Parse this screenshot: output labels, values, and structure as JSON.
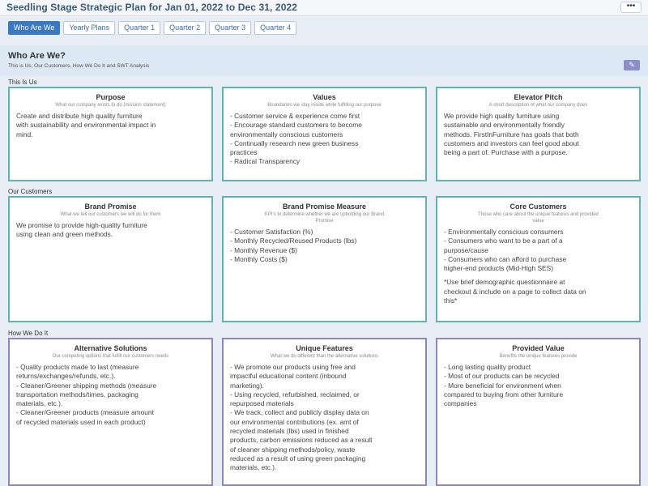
{
  "header": {
    "title": "Seedling Stage Strategic Plan for Jan 01, 2022 to Dec 31, 2022",
    "more_label": "•••"
  },
  "tabs": [
    {
      "label": "Who Are We",
      "active": true
    },
    {
      "label": "Yearly Plans",
      "active": false
    },
    {
      "label": "Quarter 1",
      "active": false
    },
    {
      "label": "Quarter 2",
      "active": false
    },
    {
      "label": "Quarter 3",
      "active": false
    },
    {
      "label": "Quarter 4",
      "active": false
    }
  ],
  "section": {
    "title": "Who Are We?",
    "subtitle": "This is Us, Our Customers, How We Do It and SWT Analysis",
    "edit_icon": "pencil-icon",
    "edit_glyph": "✎"
  },
  "groups": {
    "this_is_us": "This Is Us",
    "our_customers": "Our Customers",
    "how_we_do_it": "How We Do It"
  },
  "colors": {
    "accent": "#3b78c4",
    "teal_border": "#5fb5b0",
    "purple_border": "#8e86b8",
    "edit_button": "#8a8fc9"
  },
  "cards": {
    "purpose": {
      "title": "Purpose",
      "subtitle": "What our company exists to do (mission statement)",
      "lines": [
        "Create and distribute high quality furniture",
        "with sustainability and environmental impact in",
        "mind."
      ]
    },
    "values": {
      "title": "Values",
      "subtitle": "Boundaries we stay inside while fulfilling our purpose",
      "lines": [
        "- Customer service & experience come first",
        "- Encourage standard customers to become",
        "environmentally conscious customers",
        "- Continually research new green business",
        "practices",
        "- Radical Transparency"
      ]
    },
    "elevator_pitch": {
      "title": "Elevator Pitch",
      "subtitle": "A short description of what our company does",
      "lines": [
        "We provide high quality furniture using",
        "sustainable and environmentally friendly",
        "methods. FirstInFurniture has goals that both",
        "customers and investors can feel good about",
        "being a part of. Purchase with a purpose."
      ]
    },
    "brand_promise": {
      "title": "Brand Promise",
      "subtitle": "What we tell our customers we will do for them",
      "lines": [
        "We promise to provide high-quality furniture",
        "using clean and green methods."
      ]
    },
    "brand_promise_measure": {
      "title": "Brand Promise Measure",
      "subtitle_line1": "KPI's to determine whether we are upholding our Brand",
      "subtitle_line2": "Promise",
      "lines": [
        "- Customer Satisfaction (%)",
        "- Monthly Recycled/Reused Products (lbs)",
        "- Monthly Revenue ($)",
        "- Monthly Costs ($)"
      ]
    },
    "core_customers": {
      "title": "Core Customers",
      "subtitle_line1": "Those who care about the unique features and provided",
      "subtitle_line2": "value",
      "lines": [
        "- Environmentally conscious consumers",
        "- Consumers who want to be a part of a",
        "purpose/cause",
        "- Consumers who can afford to purchase",
        "higher-end products (Mid-High SES)"
      ],
      "note_lines": [
        "*Use brief demographic questionnaire at",
        "checkout & include on a page to collect data on",
        "this*"
      ]
    },
    "alternative_solutions": {
      "title": "Alternative Solutions",
      "subtitle": "Our competing options that fulfill our customers needs",
      "lines": [
        "- Quality products made to last (measure",
        "returns/exchanges/refunds, etc.).",
        "- Cleaner/Greener shipping methods (measure",
        "transportation methods/times, packaging",
        "materials, etc.).",
        "- Cleaner/Greener products (measure amount",
        "of recycled materials used in each product)"
      ]
    },
    "unique_features": {
      "title": "Unique Features",
      "subtitle": "What we do different than the alternative solutions",
      "lines": [
        "- We promote our products using free and",
        "impactful educational content (inbound",
        "marketing).",
        "- Using recycled, refurbished, reclaimed, or",
        "repurposed materials",
        "- We track, collect and publicly display data on",
        "our environmental contributions (ex. amt of",
        "recycled materials (lbs) used in finished",
        "products, carbon emissions reduced as a result",
        "of cleaner shipping methods/policy, waste",
        "reduced as a result of using green packaging",
        "materials, etc.)."
      ]
    },
    "provided_value": {
      "title": "Provided Value",
      "subtitle": "Benefits the unique features provide",
      "lines": [
        "- Long lasting quality product",
        "- Most of our products can be recycled",
        "- More beneficial for environment when",
        "compared to buying from other furniture",
        "companies"
      ]
    }
  }
}
